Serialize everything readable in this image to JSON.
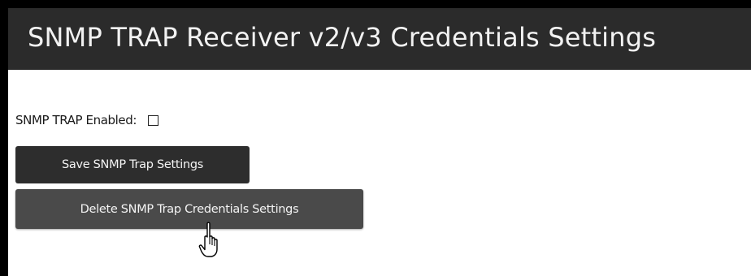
{
  "panel": {
    "title": "SNMP TRAP Receiver v2/v3 Credentials Settings"
  },
  "form": {
    "trap_enabled_label": "SNMP TRAP Enabled:",
    "trap_enabled_checked": false
  },
  "buttons": {
    "save_label": "Save SNMP Trap Settings",
    "delete_label": "Delete SNMP Trap Credentials Settings"
  },
  "cursor": {
    "icon": "hand-pointer-icon"
  },
  "colors": {
    "title_bar": "#2b2b2b",
    "button": "#2d2d2d",
    "button_hover": "#4a4a4a",
    "text_on_dark": "#f2f2f2"
  }
}
